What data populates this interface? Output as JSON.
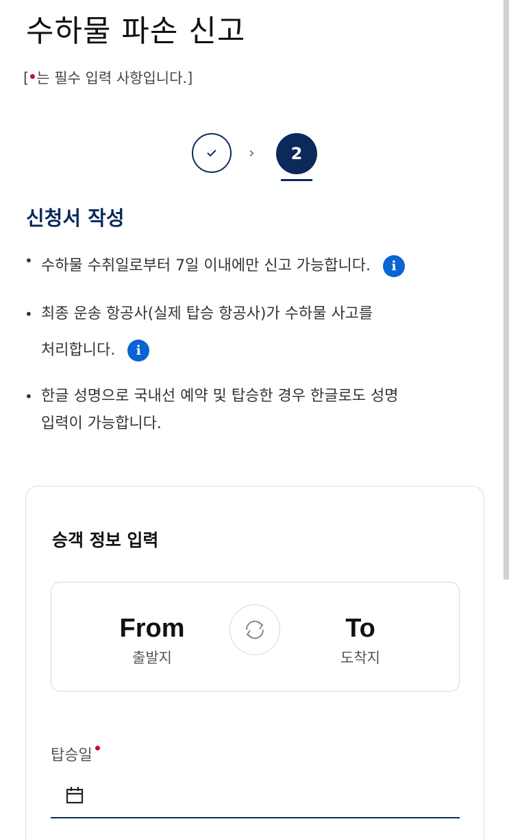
{
  "header": {
    "title": "수하물 파손 신고",
    "required_note_prefix": "[",
    "required_note_suffix": "는 필수 입력 사항입니다.]"
  },
  "stepper": {
    "step1_state": "completed",
    "step2_label": "2",
    "separator": "›"
  },
  "section": {
    "title": "신청서 작성",
    "bullets": [
      {
        "line1": "수하물 수취일로부터 7일 이내에만 신고 가능합니다.",
        "line2": ""
      },
      {
        "line1": "최종 운송 항공사(실제 탑승 항공사)가 수하물 사고를",
        "line2": "처리합니다."
      },
      {
        "line1": "한글 성명으로 국내선 예약 및 탑승한 경우 한글로도 성명",
        "line2": "입력이 가능합니다."
      }
    ],
    "bullet_symbol": "•",
    "info_glyph": "i"
  },
  "card": {
    "title": "승객 정보 입력",
    "from_label": "From",
    "from_sub": "출발지",
    "to_label": "To",
    "to_sub": "도착지",
    "date_label": "탑승일",
    "date_value": ""
  },
  "colors": {
    "brand_navy": "#0b2a5b",
    "info_blue": "#0a64d2",
    "required_red": "#c8102e"
  },
  "icons": [
    "check-icon",
    "chevron-right-icon",
    "info-icon",
    "swap-icon",
    "calendar-icon"
  ]
}
